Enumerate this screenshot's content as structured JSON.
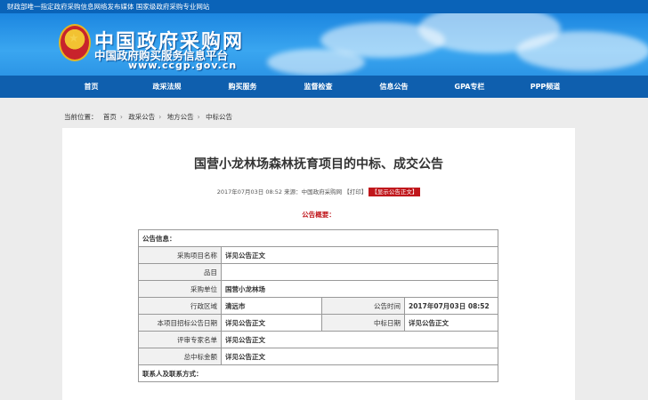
{
  "topbar": {
    "text": "财政部唯一指定政府采购信息网络发布媒体   国家级政府采购专业网站"
  },
  "header": {
    "title": "中国政府采购网",
    "subtitle": "中国政府购买服务信息平台",
    "url": "www.ccgp.gov.cn"
  },
  "nav": {
    "items": [
      "首页",
      "政采法规",
      "购买服务",
      "监督检查",
      "信息公告",
      "GPA专栏",
      "PPP频道"
    ]
  },
  "breadcrumb": {
    "label": "当前位置：",
    "items": [
      "首页",
      "政采公告",
      "地方公告",
      "中标公告"
    ]
  },
  "article": {
    "title": "国营小龙林场森林抚育项目的中标、成交公告",
    "date": "2017年07月03日  08:52",
    "source": "来源：中国政府采购网",
    "print": "【打印】",
    "show_full": "【显示公告正文】",
    "summary_label": "公告概要："
  },
  "table": {
    "header": "公告信息：",
    "project_name_label": "采购项目名称",
    "project_name_value": "详见公告正文",
    "item_label": "品目",
    "item_value": "",
    "unit_label": "采购单位",
    "unit_value": "国营小龙林场",
    "region_label": "行政区域",
    "region_value": "清远市",
    "pub_time_label": "公告时间",
    "pub_time_value": "2017年07月03日  08:52",
    "bid_date_label": "本项目招标公告日期",
    "bid_date_value": "详见公告正文",
    "award_date_label": "中标日期",
    "award_date_value": "详见公告正文",
    "experts_label": "评审专家名单",
    "experts_value": "详见公告正文",
    "amount_label": "总中标金额",
    "amount_value": "详见公告正文",
    "contact_header": "联系人及联系方式："
  }
}
